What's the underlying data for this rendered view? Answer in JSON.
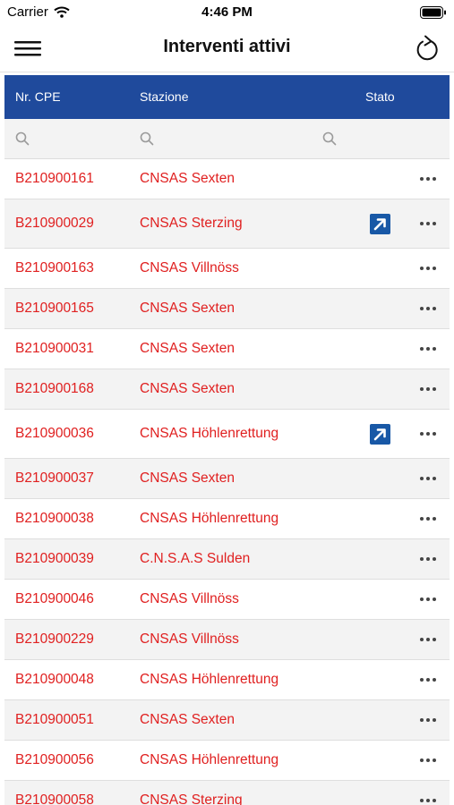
{
  "status_bar": {
    "carrier": "Carrier",
    "time": "4:46 PM"
  },
  "nav": {
    "title": "Interventi attivi"
  },
  "grid": {
    "columns": {
      "cpe": "Nr. CPE",
      "stazione": "Stazione",
      "stato": "Stato"
    },
    "header_color": "#1f4a9c",
    "text_color": "#e02020",
    "rows": [
      {
        "cpe": "B210900161",
        "stazione": "CNSAS Sexten",
        "has_status_icon": false
      },
      {
        "cpe": "B210900029",
        "stazione": "CNSAS Sterzing",
        "has_status_icon": true
      },
      {
        "cpe": "B210900163",
        "stazione": "CNSAS Villnöss",
        "has_status_icon": false
      },
      {
        "cpe": "B210900165",
        "stazione": "CNSAS Sexten",
        "has_status_icon": false
      },
      {
        "cpe": "B210900031",
        "stazione": "CNSAS Sexten",
        "has_status_icon": false
      },
      {
        "cpe": "B210900168",
        "stazione": "CNSAS Sexten",
        "has_status_icon": false
      },
      {
        "cpe": "B210900036",
        "stazione": "CNSAS Höhlenrettung",
        "has_status_icon": true
      },
      {
        "cpe": "B210900037",
        "stazione": "CNSAS Sexten",
        "has_status_icon": false
      },
      {
        "cpe": "B210900038",
        "stazione": "CNSAS Höhlenrettung",
        "has_status_icon": false
      },
      {
        "cpe": "B210900039",
        "stazione": "C.N.S.A.S Sulden",
        "has_status_icon": false
      },
      {
        "cpe": "B210900046",
        "stazione": "CNSAS Villnöss",
        "has_status_icon": false
      },
      {
        "cpe": "B210900229",
        "stazione": "CNSAS Villnöss",
        "has_status_icon": false
      },
      {
        "cpe": "B210900048",
        "stazione": "CNSAS Höhlenrettung",
        "has_status_icon": false
      },
      {
        "cpe": "B210900051",
        "stazione": "CNSAS Sexten",
        "has_status_icon": false
      },
      {
        "cpe": "B210900056",
        "stazione": "CNSAS Höhlenrettung",
        "has_status_icon": false
      },
      {
        "cpe": "B210900058",
        "stazione": "CNSAS Sterzing",
        "has_status_icon": false
      }
    ]
  }
}
